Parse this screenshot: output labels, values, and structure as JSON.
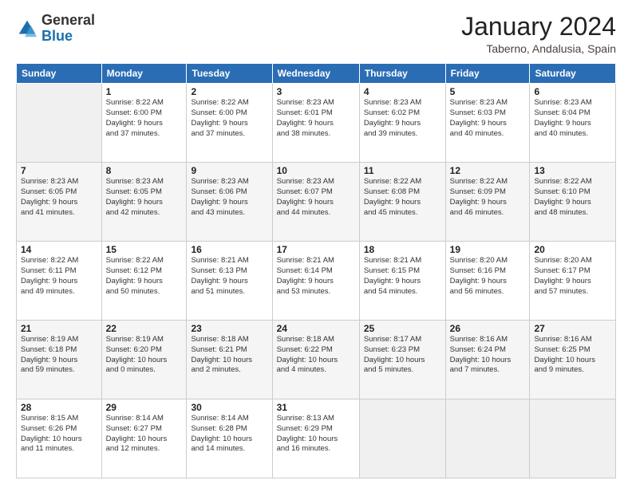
{
  "header": {
    "logo": {
      "general": "General",
      "blue": "Blue"
    },
    "title": "January 2024",
    "location": "Taberno, Andalusia, Spain"
  },
  "weekdays": [
    "Sunday",
    "Monday",
    "Tuesday",
    "Wednesday",
    "Thursday",
    "Friday",
    "Saturday"
  ],
  "weeks": [
    [
      {
        "day": "",
        "info": ""
      },
      {
        "day": "1",
        "info": "Sunrise: 8:22 AM\nSunset: 6:00 PM\nDaylight: 9 hours\nand 37 minutes."
      },
      {
        "day": "2",
        "info": "Sunrise: 8:22 AM\nSunset: 6:00 PM\nDaylight: 9 hours\nand 37 minutes."
      },
      {
        "day": "3",
        "info": "Sunrise: 8:23 AM\nSunset: 6:01 PM\nDaylight: 9 hours\nand 38 minutes."
      },
      {
        "day": "4",
        "info": "Sunrise: 8:23 AM\nSunset: 6:02 PM\nDaylight: 9 hours\nand 39 minutes."
      },
      {
        "day": "5",
        "info": "Sunrise: 8:23 AM\nSunset: 6:03 PM\nDaylight: 9 hours\nand 40 minutes."
      },
      {
        "day": "6",
        "info": "Sunrise: 8:23 AM\nSunset: 6:04 PM\nDaylight: 9 hours\nand 40 minutes."
      }
    ],
    [
      {
        "day": "7",
        "info": "Sunrise: 8:23 AM\nSunset: 6:05 PM\nDaylight: 9 hours\nand 41 minutes."
      },
      {
        "day": "8",
        "info": "Sunrise: 8:23 AM\nSunset: 6:05 PM\nDaylight: 9 hours\nand 42 minutes."
      },
      {
        "day": "9",
        "info": "Sunrise: 8:23 AM\nSunset: 6:06 PM\nDaylight: 9 hours\nand 43 minutes."
      },
      {
        "day": "10",
        "info": "Sunrise: 8:23 AM\nSunset: 6:07 PM\nDaylight: 9 hours\nand 44 minutes."
      },
      {
        "day": "11",
        "info": "Sunrise: 8:22 AM\nSunset: 6:08 PM\nDaylight: 9 hours\nand 45 minutes."
      },
      {
        "day": "12",
        "info": "Sunrise: 8:22 AM\nSunset: 6:09 PM\nDaylight: 9 hours\nand 46 minutes."
      },
      {
        "day": "13",
        "info": "Sunrise: 8:22 AM\nSunset: 6:10 PM\nDaylight: 9 hours\nand 48 minutes."
      }
    ],
    [
      {
        "day": "14",
        "info": "Sunrise: 8:22 AM\nSunset: 6:11 PM\nDaylight: 9 hours\nand 49 minutes."
      },
      {
        "day": "15",
        "info": "Sunrise: 8:22 AM\nSunset: 6:12 PM\nDaylight: 9 hours\nand 50 minutes."
      },
      {
        "day": "16",
        "info": "Sunrise: 8:21 AM\nSunset: 6:13 PM\nDaylight: 9 hours\nand 51 minutes."
      },
      {
        "day": "17",
        "info": "Sunrise: 8:21 AM\nSunset: 6:14 PM\nDaylight: 9 hours\nand 53 minutes."
      },
      {
        "day": "18",
        "info": "Sunrise: 8:21 AM\nSunset: 6:15 PM\nDaylight: 9 hours\nand 54 minutes."
      },
      {
        "day": "19",
        "info": "Sunrise: 8:20 AM\nSunset: 6:16 PM\nDaylight: 9 hours\nand 56 minutes."
      },
      {
        "day": "20",
        "info": "Sunrise: 8:20 AM\nSunset: 6:17 PM\nDaylight: 9 hours\nand 57 minutes."
      }
    ],
    [
      {
        "day": "21",
        "info": "Sunrise: 8:19 AM\nSunset: 6:18 PM\nDaylight: 9 hours\nand 59 minutes."
      },
      {
        "day": "22",
        "info": "Sunrise: 8:19 AM\nSunset: 6:20 PM\nDaylight: 10 hours\nand 0 minutes."
      },
      {
        "day": "23",
        "info": "Sunrise: 8:18 AM\nSunset: 6:21 PM\nDaylight: 10 hours\nand 2 minutes."
      },
      {
        "day": "24",
        "info": "Sunrise: 8:18 AM\nSunset: 6:22 PM\nDaylight: 10 hours\nand 4 minutes."
      },
      {
        "day": "25",
        "info": "Sunrise: 8:17 AM\nSunset: 6:23 PM\nDaylight: 10 hours\nand 5 minutes."
      },
      {
        "day": "26",
        "info": "Sunrise: 8:16 AM\nSunset: 6:24 PM\nDaylight: 10 hours\nand 7 minutes."
      },
      {
        "day": "27",
        "info": "Sunrise: 8:16 AM\nSunset: 6:25 PM\nDaylight: 10 hours\nand 9 minutes."
      }
    ],
    [
      {
        "day": "28",
        "info": "Sunrise: 8:15 AM\nSunset: 6:26 PM\nDaylight: 10 hours\nand 11 minutes."
      },
      {
        "day": "29",
        "info": "Sunrise: 8:14 AM\nSunset: 6:27 PM\nDaylight: 10 hours\nand 12 minutes."
      },
      {
        "day": "30",
        "info": "Sunrise: 8:14 AM\nSunset: 6:28 PM\nDaylight: 10 hours\nand 14 minutes."
      },
      {
        "day": "31",
        "info": "Sunrise: 8:13 AM\nSunset: 6:29 PM\nDaylight: 10 hours\nand 16 minutes."
      },
      {
        "day": "",
        "info": ""
      },
      {
        "day": "",
        "info": ""
      },
      {
        "day": "",
        "info": ""
      }
    ]
  ]
}
